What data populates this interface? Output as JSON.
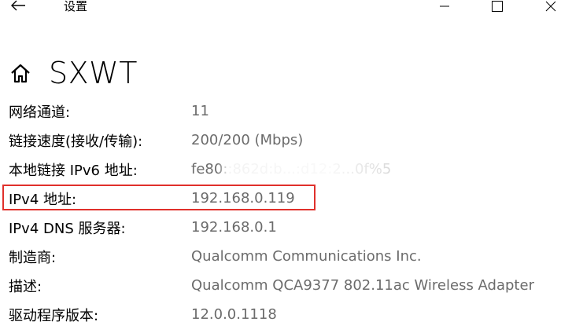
{
  "window": {
    "title": "设置",
    "back_icon": "arrow-left-icon",
    "minimize_icon": "minimize-icon",
    "maximize_icon": "maximize-icon",
    "close_icon": "close-icon"
  },
  "header": {
    "home_icon": "home-icon",
    "title": "SXWT"
  },
  "properties": [
    {
      "label": "网络通道:",
      "value": "11"
    },
    {
      "label": "链接速度(接收/传输):",
      "value": "200/200 (Mbps)"
    },
    {
      "label": "本地链接 IPv6 地址:",
      "value": "fe80::862d:b...:d12:2...0f%5"
    },
    {
      "label": "IPv4 地址:",
      "value": "192.168.0.119"
    },
    {
      "label": "IPv4 DNS 服务器:",
      "value": "192.168.0.1"
    },
    {
      "label": "制造商:",
      "value": "Qualcomm Communications Inc."
    },
    {
      "label": "描述:",
      "value": "Qualcomm QCA9377 802.11ac Wireless Adapter"
    },
    {
      "label": "驱动程序版本:",
      "value": "12.0.0.1118"
    }
  ],
  "colors": {
    "label": "#000000",
    "value": "#6b6b6b",
    "highlight_border": "#e0302b",
    "background": "#ffffff"
  }
}
